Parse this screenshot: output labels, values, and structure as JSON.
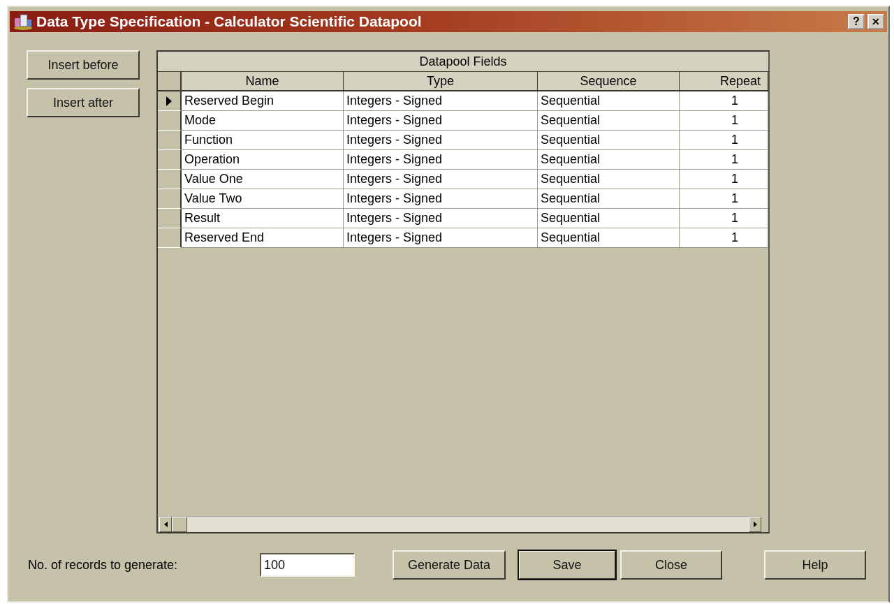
{
  "window": {
    "title": "Data Type Specification - Calculator Scientific Datapool",
    "title_buttons": [
      {
        "kind": "help",
        "label": "?"
      },
      {
        "kind": "close",
        "label": "✕"
      }
    ]
  },
  "side_buttons": [
    "Insert before",
    "Insert after"
  ],
  "table": {
    "caption": "Datapool Fields",
    "columns": [
      "Name",
      "Type",
      "Sequence",
      "Repeat"
    ],
    "rows": [
      {
        "selected": true,
        "cells": [
          "Reserved Begin",
          "Integers - Signed",
          "Sequential",
          "1"
        ]
      },
      {
        "selected": false,
        "cells": [
          "Mode",
          "Integers - Signed",
          "Sequential",
          "1"
        ]
      },
      {
        "selected": false,
        "cells": [
          "Function",
          "Integers - Signed",
          "Sequential",
          "1"
        ]
      },
      {
        "selected": false,
        "cells": [
          "Operation",
          "Integers - Signed",
          "Sequential",
          "1"
        ]
      },
      {
        "selected": false,
        "cells": [
          "Value One",
          "Integers - Signed",
          "Sequential",
          "1"
        ]
      },
      {
        "selected": false,
        "cells": [
          "Value Two",
          "Integers - Signed",
          "Sequential",
          "1"
        ]
      },
      {
        "selected": false,
        "cells": [
          "Result",
          "Integers - Signed",
          "Sequential",
          "1"
        ]
      },
      {
        "selected": false,
        "cells": [
          "Reserved End",
          "Integers - Signed",
          "Sequential",
          "1"
        ]
      }
    ]
  },
  "records": {
    "label": "No. of records to generate:",
    "value": "100"
  },
  "buttons": [
    {
      "label": "Generate Data",
      "default": false
    },
    {
      "label": "Save",
      "default": true
    },
    {
      "label": "Close",
      "default": false
    },
    {
      "label": "Help",
      "default": false
    }
  ]
}
